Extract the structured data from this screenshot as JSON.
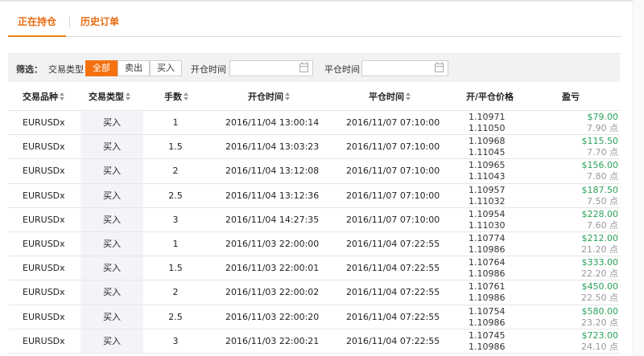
{
  "tabs": [
    {
      "label": "正在持仓",
      "active": true
    },
    {
      "label": "历史订单",
      "active": false
    }
  ],
  "filter": {
    "label": "筛选：",
    "type_label": "交易类型",
    "buttons": [
      {
        "label": "全部",
        "active": true
      },
      {
        "label": "卖出",
        "active": false
      },
      {
        "label": "买入",
        "active": false
      }
    ],
    "open_time_label": "开仓时间",
    "open_time_value": "",
    "close_time_label": "平仓时间",
    "close_time_value": ""
  },
  "table": {
    "headers": [
      "交易品种",
      "交易类型",
      "手数",
      "开仓时间",
      "平仓时间",
      "开/平仓价格",
      "盈亏"
    ],
    "rows": [
      {
        "symbol": "EURUSDx",
        "type": "买入",
        "lots": "1",
        "open_time": "2016/11/04 13:00:14",
        "close_time": "2016/11/07 07:10:00",
        "open_price": "1.10971",
        "close_price": "1.11050",
        "profit": "$79.00",
        "points": "7.90 点"
      },
      {
        "symbol": "EURUSDx",
        "type": "买入",
        "lots": "1.5",
        "open_time": "2016/11/04 13:03:23",
        "close_time": "2016/11/07 07:10:00",
        "open_price": "1.10968",
        "close_price": "1.11045",
        "profit": "$115.50",
        "points": "7.70 点"
      },
      {
        "symbol": "EURUSDx",
        "type": "买入",
        "lots": "2",
        "open_time": "2016/11/04 13:12:08",
        "close_time": "2016/11/07 07:10:00",
        "open_price": "1.10965",
        "close_price": "1.11043",
        "profit": "$156.00",
        "points": "7.80 点"
      },
      {
        "symbol": "EURUSDx",
        "type": "买入",
        "lots": "2.5",
        "open_time": "2016/11/04 13:12:36",
        "close_time": "2016/11/07 07:10:00",
        "open_price": "1.10957",
        "close_price": "1.11032",
        "profit": "$187.50",
        "points": "7.50 点"
      },
      {
        "symbol": "EURUSDx",
        "type": "买入",
        "lots": "3",
        "open_time": "2016/11/04 14:27:35",
        "close_time": "2016/11/07 07:10:00",
        "open_price": "1.10954",
        "close_price": "1.11030",
        "profit": "$228.00",
        "points": "7.60 点"
      },
      {
        "symbol": "EURUSDx",
        "type": "买入",
        "lots": "1",
        "open_time": "2016/11/03 22:00:00",
        "close_time": "2016/11/04 07:22:55",
        "open_price": "1.10774",
        "close_price": "1.10986",
        "profit": "$212.00",
        "points": "21.20 点"
      },
      {
        "symbol": "EURUSDx",
        "type": "买入",
        "lots": "1.5",
        "open_time": "2016/11/03 22:00:01",
        "close_time": "2016/11/04 07:22:55",
        "open_price": "1.10764",
        "close_price": "1.10986",
        "profit": "$333.00",
        "points": "22.20 点"
      },
      {
        "symbol": "EURUSDx",
        "type": "买入",
        "lots": "2",
        "open_time": "2016/11/03 22:00:02",
        "close_time": "2016/11/04 07:22:55",
        "open_price": "1.10761",
        "close_price": "1.10986",
        "profit": "$450.00",
        "points": "22.50 点"
      },
      {
        "symbol": "EURUSDx",
        "type": "买入",
        "lots": "2.5",
        "open_time": "2016/11/03 22:00:20",
        "close_time": "2016/11/04 07:22:55",
        "open_price": "1.10754",
        "close_price": "1.10986",
        "profit": "$580.00",
        "points": "23.20 点"
      },
      {
        "symbol": "EURUSDx",
        "type": "买入",
        "lots": "3",
        "open_time": "2016/11/03 22:00:21",
        "close_time": "2016/11/04 07:22:55",
        "open_price": "1.10745",
        "close_price": "1.10986",
        "profit": "$723.00",
        "points": "24.10 点"
      }
    ]
  },
  "colors": {
    "accent": "#f5700f",
    "profit": "#2aa35a",
    "muted": "#999999"
  }
}
